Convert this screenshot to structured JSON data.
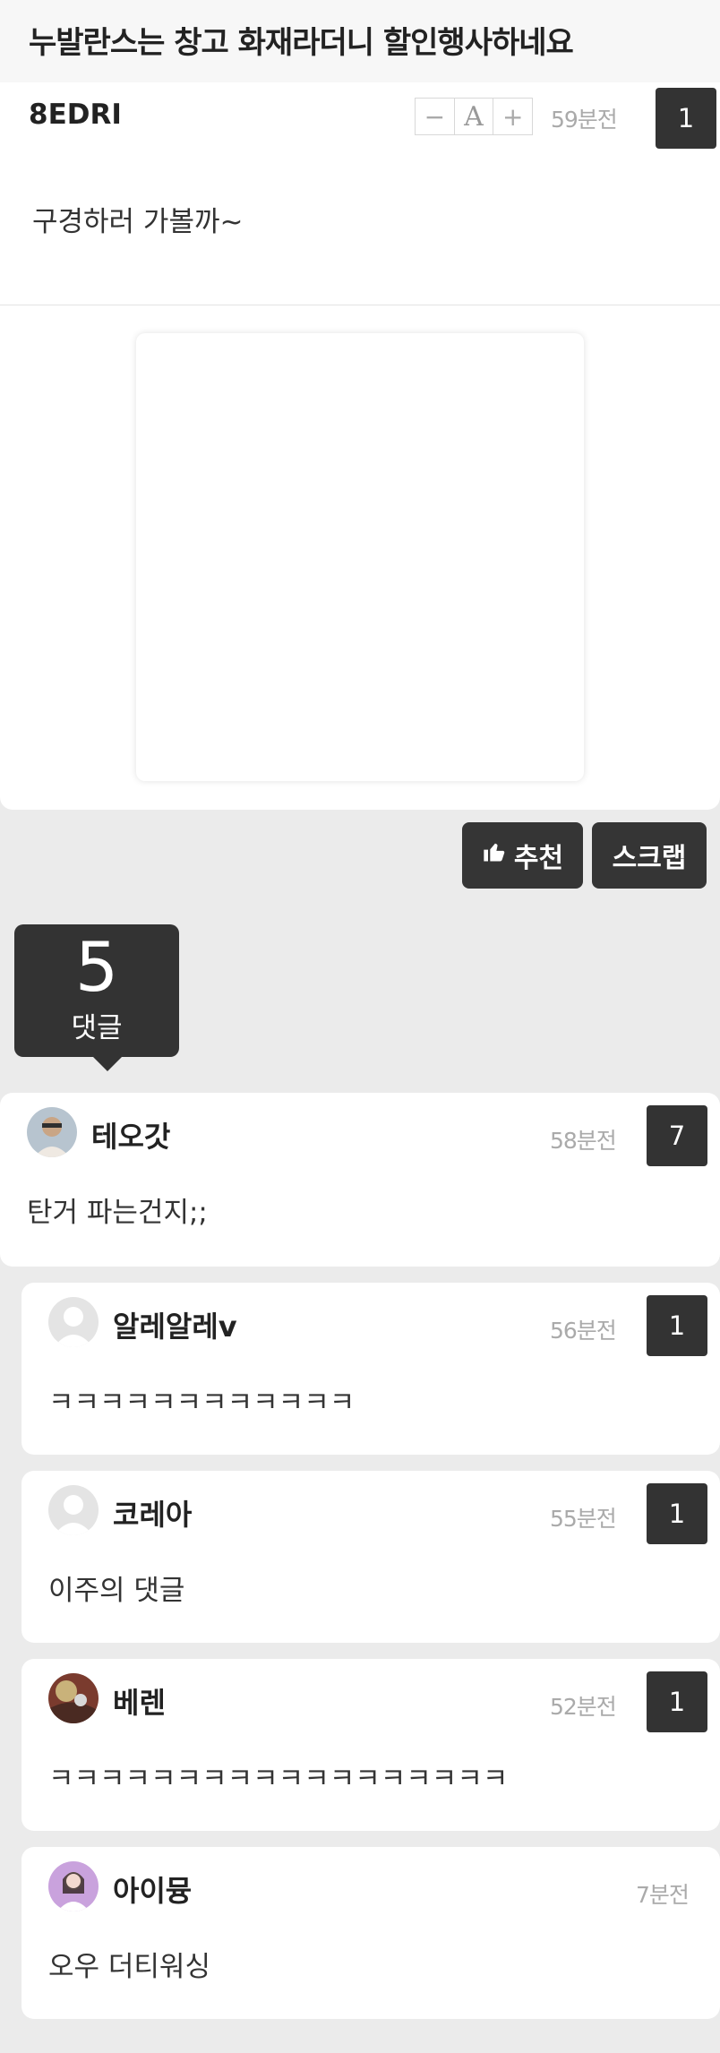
{
  "post": {
    "title": "누발란스는 창고 화재라더니 할인행사하네요",
    "author": "8EDRI",
    "font_decrease": "−",
    "font_label": "A",
    "font_increase": "+",
    "time": "59분전",
    "recommend_count": "1",
    "body": "구경하러 가볼까~"
  },
  "actions": {
    "recommend_label": "추천",
    "scrap_label": "스크랩"
  },
  "comments_header": {
    "count": "5",
    "label": "댓글"
  },
  "comments": [
    {
      "author": "테오갓",
      "time": "58분전",
      "recommend_count": "7",
      "body": "탄거 파는건지;;"
    },
    {
      "author": "알레알레v",
      "time": "56분전",
      "recommend_count": "1",
      "body": "ㅋㅋㅋㅋㅋㅋㅋㅋㅋㅋㅋㅋ"
    },
    {
      "author": "코레아",
      "time": "55분전",
      "recommend_count": "1",
      "body": "이주의 댓글"
    },
    {
      "author": "베렌",
      "time": "52분전",
      "recommend_count": "1",
      "body": "ㅋㅋㅋㅋㅋㅋㅋㅋㅋㅋㅋㅋㅋㅋㅋㅋㅋㅋ"
    },
    {
      "author": "아이뮹",
      "time": "7분전",
      "body": "오우 더티워싱"
    }
  ],
  "colors": {
    "dark_badge": "#333333",
    "page_background": "#ebebeb",
    "meta_text": "#aaaaaa"
  }
}
